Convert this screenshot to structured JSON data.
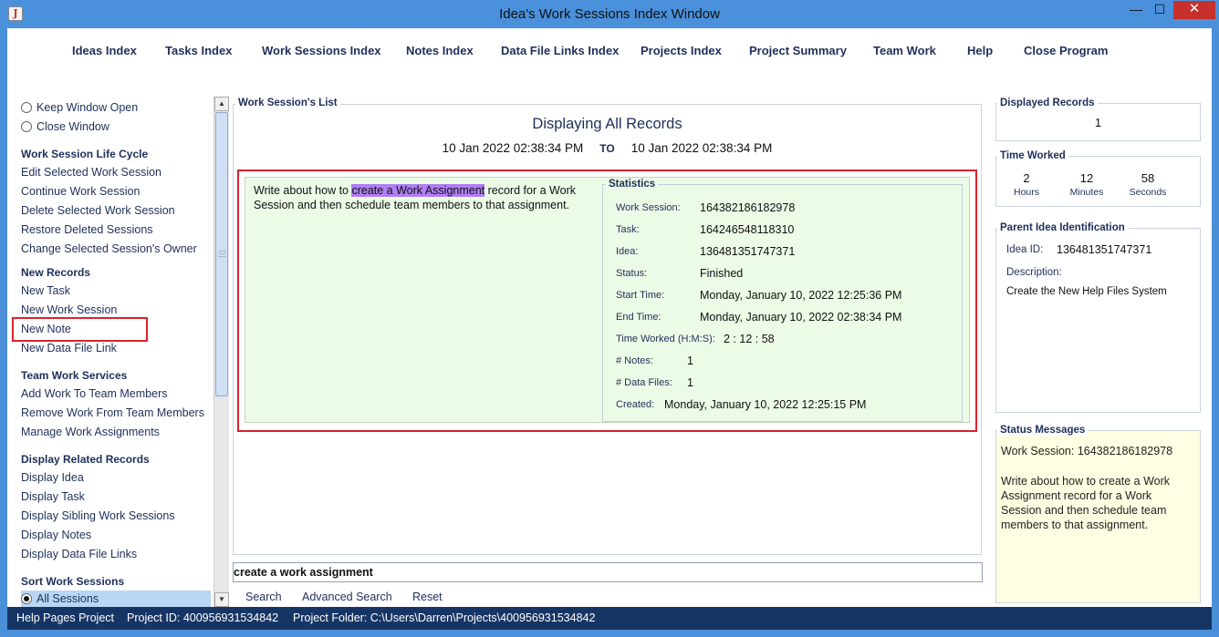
{
  "window": {
    "title": "Idea's Work Sessions Index Window",
    "min_glyph": "—",
    "max_glyph": "☐",
    "close_glyph": "✕",
    "app_icon": "java-icon",
    "app_icon_glyph": "J"
  },
  "menu": {
    "ideas": "Ideas Index",
    "tasks": "Tasks Index",
    "work_sessions": "Work Sessions Index",
    "notes": "Notes Index",
    "data_file_links": "Data File Links Index",
    "projects": "Projects Index",
    "project_summary": "Project Summary",
    "team_work": "Team Work",
    "help": "Help",
    "close_program": "Close Program"
  },
  "left": {
    "keep_window_open": "Keep Window Open",
    "close_window": "Close Window",
    "life_cycle": {
      "heading": "Work Session Life Cycle",
      "items": [
        "Edit Selected Work Session",
        "Continue Work Session",
        "Delete Selected Work Session",
        "Restore Deleted Sessions",
        "Change Selected Session's Owner"
      ]
    },
    "new_records": {
      "heading": "New Records",
      "items": [
        "New Task",
        "New Work Session",
        "New Note",
        "New Data File Link"
      ]
    },
    "team_work": {
      "heading": "Team Work Services",
      "items": [
        "Add Work To Team Members",
        "Remove Work From Team Members",
        "Manage Work Assignments"
      ]
    },
    "related": {
      "heading": "Display Related Records",
      "items": [
        "Display Idea",
        "Display Task",
        "Display Sibling Work Sessions",
        "Display Notes",
        "Display Data File Links"
      ]
    },
    "sort": {
      "heading": "Sort Work Sessions",
      "selected": "All Sessions"
    }
  },
  "center": {
    "group_title": "Work Session's List",
    "displaying": "Displaying All Records",
    "date_from": "10 Jan 2022  02:38:34 PM",
    "to_label": "TO",
    "date_to": "10 Jan 2022  02:38:34 PM",
    "note_before": "Write about how to ",
    "note_highlight": "create a Work Assignment",
    "note_after": " record for a Work Session and then schedule team members to that assignment.",
    "stats": {
      "title": "Statistics",
      "work_session_label": "Work Session:",
      "work_session": "164382186182978",
      "task_label": "Task:",
      "task": "164246548118310",
      "idea_label": "Idea:",
      "idea": "136481351747371",
      "status_label": "Status:",
      "status": "Finished",
      "start_label": "Start Time:",
      "start": "Monday, January 10, 2022   12:25:36 PM",
      "end_label": "End Time:",
      "end": "Monday, January 10, 2022   02:38:34 PM",
      "worked_label": "Time Worked (H:M:S):",
      "worked": "2   :  12  :  58",
      "notes_label": "# Notes:",
      "notes": "1",
      "files_label": "# Data Files:",
      "files": "1",
      "created_label": "Created:",
      "created": "Monday, January 10, 2022   12:25:15 PM"
    },
    "search_value": "create a work assignment",
    "search": "Search",
    "advanced_search": "Advanced Search",
    "reset": "Reset"
  },
  "right": {
    "displayed": {
      "title": "Displayed Records",
      "value": "1"
    },
    "time_worked": {
      "title": "Time Worked",
      "hours": "2",
      "hours_label": "Hours",
      "minutes": "12",
      "minutes_label": "Minutes",
      "seconds": "58",
      "seconds_label": "Seconds"
    },
    "parent": {
      "title": "Parent Idea Identification",
      "id_label": "Idea ID:",
      "id": "136481351747371",
      "desc_label": "Description:",
      "desc": "Create the New Help Files System"
    },
    "status": {
      "title": "Status Messages",
      "line1": "Work Session: 164382186182978",
      "line2": "Write about how to create a Work Assignment record for a Work Session and then schedule team members to that assignment."
    }
  },
  "footer": {
    "project": "Help Pages Project",
    "project_id": "Project ID:  400956931534842",
    "folder": "Project Folder:  C:\\Users\\Darren\\Projects\\400956931534842"
  },
  "colors": {
    "highlight": "#b07ef5",
    "callout": "#d9232d",
    "footer": "#173564",
    "title_bar": "#4a90da"
  }
}
